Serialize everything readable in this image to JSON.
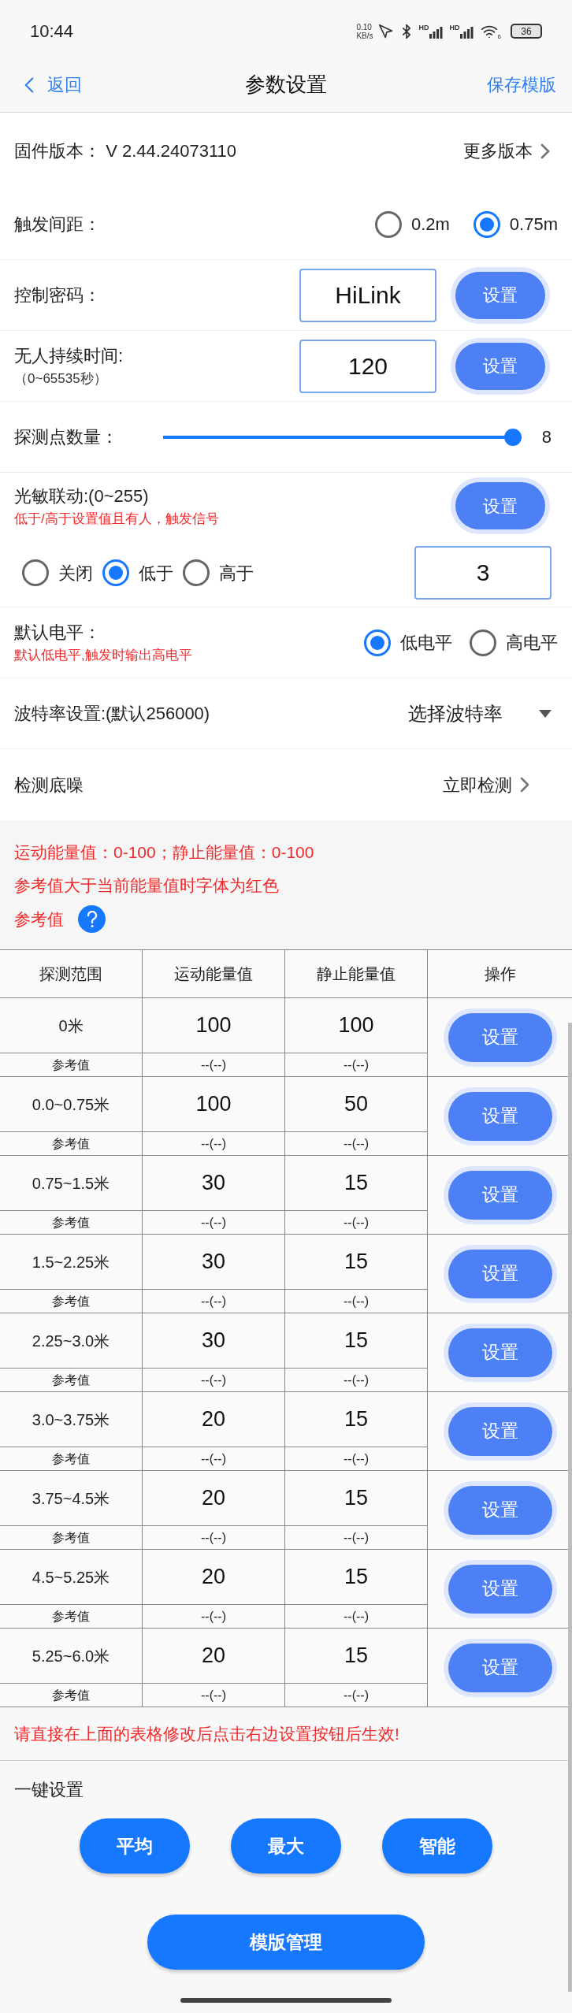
{
  "status_bar": {
    "time": "10:44",
    "speed_value": "0.10",
    "speed_unit": "KB/s",
    "signal_labels": [
      "HD",
      "HD"
    ],
    "wifi_number": "6",
    "battery": "36"
  },
  "nav": {
    "back": "返回",
    "title": "参数设置",
    "action": "保存模版"
  },
  "firmware": {
    "label": "固件版本：",
    "version": "V 2.44.24073110",
    "more": "更多版本"
  },
  "trigger_distance": {
    "label": "触发间距：",
    "options": [
      {
        "label": "0.2m",
        "selected": false
      },
      {
        "label": "0.75m",
        "selected": true
      }
    ]
  },
  "password": {
    "label": "控制密码：",
    "value": "HiLink",
    "button": "设置"
  },
  "unmanned_time": {
    "label": "无人持续时间:",
    "hint": "（0~65535秒）",
    "value": "120",
    "button": "设置"
  },
  "probe_points": {
    "label": "探测点数量：",
    "level": 1,
    "reading": "8"
  },
  "light": {
    "label": "光敏联动:(0~255)",
    "note": "低于/高于设置值且有人，触发信号",
    "button": "设置",
    "options": [
      {
        "label": "关闭",
        "selected": false
      },
      {
        "label": "低于",
        "selected": true
      },
      {
        "label": "高于",
        "selected": false
      }
    ],
    "value": "3"
  },
  "default_level": {
    "label": "默认电平：",
    "note": "默认低电平,触发时输出高电平",
    "options": [
      {
        "label": "低电平",
        "selected": true
      },
      {
        "label": "高电平",
        "selected": false
      }
    ]
  },
  "baud": {
    "label": "波特率设置:(默认256000)",
    "select": "选择波特率"
  },
  "noise": {
    "label": "检测底噪",
    "action": "立即检测"
  },
  "notes": [
    "运动能量值：0-100；静止能量值：0-100",
    "参考值大于当前能量值时字体为红色"
  ],
  "ref_label": "参考值",
  "table": {
    "columns": [
      "探测范围",
      "运动能量值",
      "静止能量值",
      "操作"
    ],
    "rows": [
      {
        "range": "0米",
        "motion": "100",
        "static": "100",
        "ref_label": "参考值",
        "motion_ref": "--(--)",
        "static_ref": "--(--)",
        "button": "设置"
      },
      {
        "range": "0.0~0.75米",
        "motion": "100",
        "static": "50",
        "ref_label": "参考值",
        "motion_ref": "--(--)",
        "static_ref": "--(--)",
        "button": "设置"
      },
      {
        "range": "0.75~1.5米",
        "motion": "30",
        "static": "15",
        "ref_label": "参考值",
        "motion_ref": "--(--)",
        "static_ref": "--(--)",
        "button": "设置"
      },
      {
        "range": "1.5~2.25米",
        "motion": "30",
        "static": "15",
        "ref_label": "参考值",
        "motion_ref": "--(--)",
        "static_ref": "--(--)",
        "button": "设置"
      },
      {
        "range": "2.25~3.0米",
        "motion": "30",
        "static": "15",
        "ref_label": "参考值",
        "motion_ref": "--(--)",
        "static_ref": "--(--)",
        "button": "设置"
      },
      {
        "range": "3.0~3.75米",
        "motion": "20",
        "static": "15",
        "ref_label": "参考值",
        "motion_ref": "--(--)",
        "static_ref": "--(--)",
        "button": "设置"
      },
      {
        "range": "3.75~4.5米",
        "motion": "20",
        "static": "15",
        "ref_label": "参考值",
        "motion_ref": "--(--)",
        "static_ref": "--(--)",
        "button": "设置"
      },
      {
        "range": "4.5~5.25米",
        "motion": "20",
        "static": "15",
        "ref_label": "参考值",
        "motion_ref": "--(--)",
        "static_ref": "--(--)",
        "button": "设置"
      },
      {
        "range": "5.25~6.0米",
        "motion": "20",
        "static": "15",
        "ref_label": "参考值",
        "motion_ref": "--(--)",
        "static_ref": "--(--)",
        "button": "设置"
      }
    ]
  },
  "hint": "请直接在上面的表格修改后点击右边设置按钮后生效!",
  "quick": {
    "title": "一键设置",
    "buttons": [
      "平均",
      "最大",
      "智能"
    ]
  },
  "template_button": "模版管理"
}
